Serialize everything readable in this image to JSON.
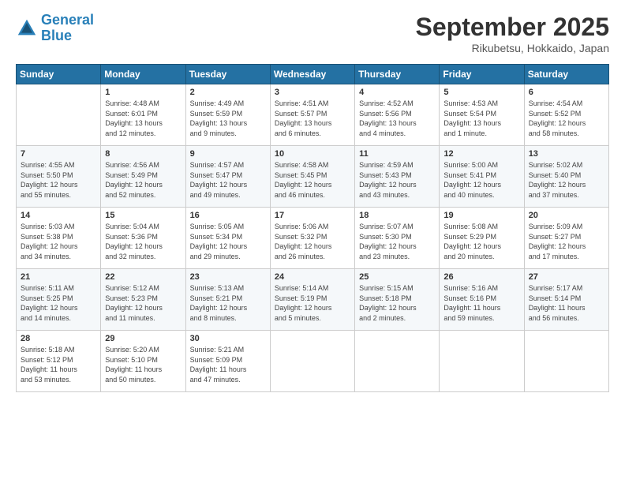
{
  "header": {
    "logo_line1": "General",
    "logo_line2": "Blue",
    "month_title": "September 2025",
    "location": "Rikubetsu, Hokkaido, Japan"
  },
  "days_of_week": [
    "Sunday",
    "Monday",
    "Tuesday",
    "Wednesday",
    "Thursday",
    "Friday",
    "Saturday"
  ],
  "weeks": [
    [
      {
        "day": "",
        "info": ""
      },
      {
        "day": "1",
        "info": "Sunrise: 4:48 AM\nSunset: 6:01 PM\nDaylight: 13 hours\nand 12 minutes."
      },
      {
        "day": "2",
        "info": "Sunrise: 4:49 AM\nSunset: 5:59 PM\nDaylight: 13 hours\nand 9 minutes."
      },
      {
        "day": "3",
        "info": "Sunrise: 4:51 AM\nSunset: 5:57 PM\nDaylight: 13 hours\nand 6 minutes."
      },
      {
        "day": "4",
        "info": "Sunrise: 4:52 AM\nSunset: 5:56 PM\nDaylight: 13 hours\nand 4 minutes."
      },
      {
        "day": "5",
        "info": "Sunrise: 4:53 AM\nSunset: 5:54 PM\nDaylight: 13 hours\nand 1 minute."
      },
      {
        "day": "6",
        "info": "Sunrise: 4:54 AM\nSunset: 5:52 PM\nDaylight: 12 hours\nand 58 minutes."
      }
    ],
    [
      {
        "day": "7",
        "info": "Sunrise: 4:55 AM\nSunset: 5:50 PM\nDaylight: 12 hours\nand 55 minutes."
      },
      {
        "day": "8",
        "info": "Sunrise: 4:56 AM\nSunset: 5:49 PM\nDaylight: 12 hours\nand 52 minutes."
      },
      {
        "day": "9",
        "info": "Sunrise: 4:57 AM\nSunset: 5:47 PM\nDaylight: 12 hours\nand 49 minutes."
      },
      {
        "day": "10",
        "info": "Sunrise: 4:58 AM\nSunset: 5:45 PM\nDaylight: 12 hours\nand 46 minutes."
      },
      {
        "day": "11",
        "info": "Sunrise: 4:59 AM\nSunset: 5:43 PM\nDaylight: 12 hours\nand 43 minutes."
      },
      {
        "day": "12",
        "info": "Sunrise: 5:00 AM\nSunset: 5:41 PM\nDaylight: 12 hours\nand 40 minutes."
      },
      {
        "day": "13",
        "info": "Sunrise: 5:02 AM\nSunset: 5:40 PM\nDaylight: 12 hours\nand 37 minutes."
      }
    ],
    [
      {
        "day": "14",
        "info": "Sunrise: 5:03 AM\nSunset: 5:38 PM\nDaylight: 12 hours\nand 34 minutes."
      },
      {
        "day": "15",
        "info": "Sunrise: 5:04 AM\nSunset: 5:36 PM\nDaylight: 12 hours\nand 32 minutes."
      },
      {
        "day": "16",
        "info": "Sunrise: 5:05 AM\nSunset: 5:34 PM\nDaylight: 12 hours\nand 29 minutes."
      },
      {
        "day": "17",
        "info": "Sunrise: 5:06 AM\nSunset: 5:32 PM\nDaylight: 12 hours\nand 26 minutes."
      },
      {
        "day": "18",
        "info": "Sunrise: 5:07 AM\nSunset: 5:30 PM\nDaylight: 12 hours\nand 23 minutes."
      },
      {
        "day": "19",
        "info": "Sunrise: 5:08 AM\nSunset: 5:29 PM\nDaylight: 12 hours\nand 20 minutes."
      },
      {
        "day": "20",
        "info": "Sunrise: 5:09 AM\nSunset: 5:27 PM\nDaylight: 12 hours\nand 17 minutes."
      }
    ],
    [
      {
        "day": "21",
        "info": "Sunrise: 5:11 AM\nSunset: 5:25 PM\nDaylight: 12 hours\nand 14 minutes."
      },
      {
        "day": "22",
        "info": "Sunrise: 5:12 AM\nSunset: 5:23 PM\nDaylight: 12 hours\nand 11 minutes."
      },
      {
        "day": "23",
        "info": "Sunrise: 5:13 AM\nSunset: 5:21 PM\nDaylight: 12 hours\nand 8 minutes."
      },
      {
        "day": "24",
        "info": "Sunrise: 5:14 AM\nSunset: 5:19 PM\nDaylight: 12 hours\nand 5 minutes."
      },
      {
        "day": "25",
        "info": "Sunrise: 5:15 AM\nSunset: 5:18 PM\nDaylight: 12 hours\nand 2 minutes."
      },
      {
        "day": "26",
        "info": "Sunrise: 5:16 AM\nSunset: 5:16 PM\nDaylight: 11 hours\nand 59 minutes."
      },
      {
        "day": "27",
        "info": "Sunrise: 5:17 AM\nSunset: 5:14 PM\nDaylight: 11 hours\nand 56 minutes."
      }
    ],
    [
      {
        "day": "28",
        "info": "Sunrise: 5:18 AM\nSunset: 5:12 PM\nDaylight: 11 hours\nand 53 minutes."
      },
      {
        "day": "29",
        "info": "Sunrise: 5:20 AM\nSunset: 5:10 PM\nDaylight: 11 hours\nand 50 minutes."
      },
      {
        "day": "30",
        "info": "Sunrise: 5:21 AM\nSunset: 5:09 PM\nDaylight: 11 hours\nand 47 minutes."
      },
      {
        "day": "",
        "info": ""
      },
      {
        "day": "",
        "info": ""
      },
      {
        "day": "",
        "info": ""
      },
      {
        "day": "",
        "info": ""
      }
    ]
  ]
}
